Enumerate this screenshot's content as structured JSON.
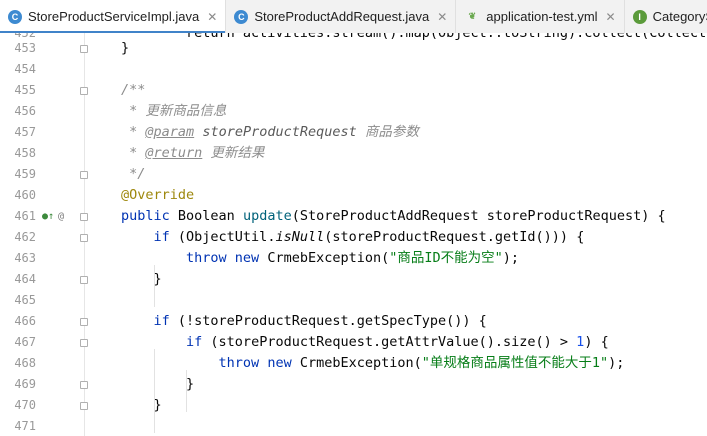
{
  "tabs": [
    {
      "label": "StoreProductServiceImpl.java",
      "icon": "class-icon",
      "active": true
    },
    {
      "label": "StoreProductAddRequest.java",
      "icon": "class-icon",
      "active": false
    },
    {
      "label": "application-test.yml",
      "icon": "yml-icon",
      "active": false
    },
    {
      "label": "CategorySer",
      "icon": "interface-icon",
      "active": false
    }
  ],
  "gutter": {
    "override_marker": "●↑",
    "at_marker": "@"
  },
  "lines": [
    {
      "n": "452",
      "text": "        return activities.stream().map(Object::toString).collect(Collectors.jo"
    },
    {
      "n": "453",
      "text": "    }"
    },
    {
      "n": "454",
      "text": ""
    },
    {
      "n": "455",
      "text": "    /**"
    },
    {
      "n": "456",
      "text": "     * 更新商品信息"
    },
    {
      "n": "457",
      "text": "     * @param storeProductRequest 商品参数"
    },
    {
      "n": "458",
      "text": "     * @return 更新结果"
    },
    {
      "n": "459",
      "text": "     */"
    },
    {
      "n": "460",
      "text": "    @Override"
    },
    {
      "n": "461",
      "text": "    public Boolean update(StoreProductAddRequest storeProductRequest) {"
    },
    {
      "n": "462",
      "text": "        if (ObjectUtil.isNull(storeProductRequest.getId())) {"
    },
    {
      "n": "463",
      "text": "            throw new CrmebException(\"商品ID不能为空\");"
    },
    {
      "n": "464",
      "text": "        }"
    },
    {
      "n": "465",
      "text": ""
    },
    {
      "n": "466",
      "text": "        if (!storeProductRequest.getSpecType()) {"
    },
    {
      "n": "467",
      "text": "            if (storeProductRequest.getAttrValue().size() > 1) {"
    },
    {
      "n": "468",
      "text": "                throw new CrmebException(\"单规格商品属性值不能大于1\");"
    },
    {
      "n": "469",
      "text": "            }"
    },
    {
      "n": "470",
      "text": "        }"
    },
    {
      "n": "471",
      "text": ""
    }
  ],
  "colors": {
    "keyword": "#0033b3",
    "comment": "#8c8c8c",
    "annotation": "#9e880d",
    "string": "#067d17",
    "number": "#1750eb",
    "tab_accent": "#4083c9"
  }
}
